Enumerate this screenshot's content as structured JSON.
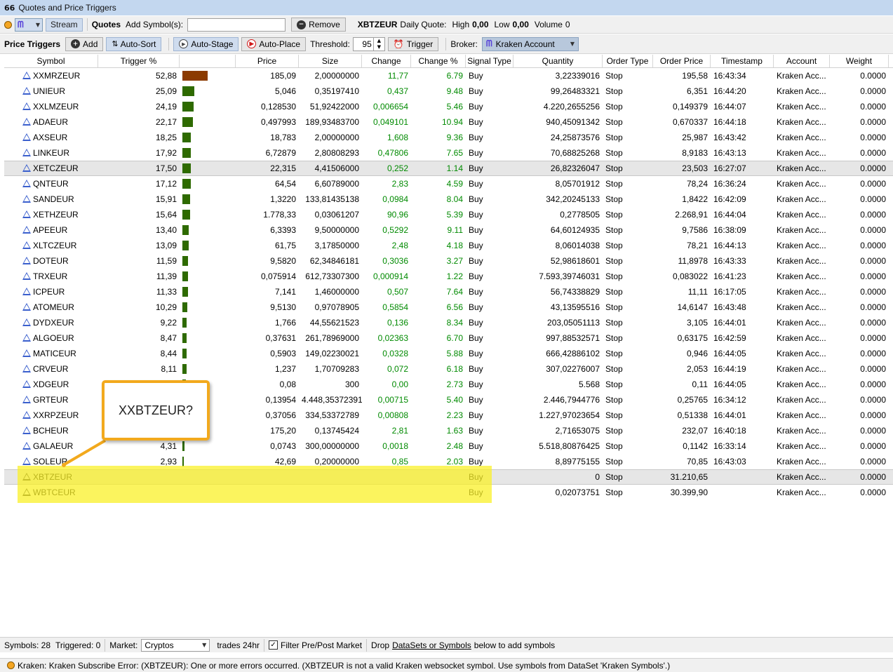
{
  "window": {
    "title": "Quotes and Price Triggers"
  },
  "quotes_bar": {
    "stream_label": "Stream",
    "quotes_label": "Quotes",
    "add_symbols_label": "Add Symbol(s):",
    "add_symbols_value": "",
    "remove_label": "Remove",
    "quote_symbol": "XBTZEUR",
    "daily_quote_label": "Daily Quote:",
    "high_label": "High",
    "high_value": "0,00",
    "low_label": "Low",
    "low_value": "0,00",
    "volume_label": "Volume",
    "volume_value": "0"
  },
  "trigger_bar": {
    "title": "Price Triggers",
    "add_label": "Add",
    "auto_sort_label": "Auto-Sort",
    "auto_stage_label": "Auto-Stage",
    "auto_place_label": "Auto-Place",
    "threshold_label": "Threshold:",
    "threshold_value": "95",
    "trigger_label": "Trigger",
    "broker_label": "Broker:",
    "broker_value": "Kraken Account"
  },
  "columns": [
    "Symbol",
    "Trigger %",
    "",
    "Price",
    "Size",
    "Change",
    "Change %",
    "Signal Type",
    "Quantity",
    "Order Type",
    "Order Price",
    "Timestamp",
    "Account",
    "Weight"
  ],
  "rows": [
    {
      "symbol": "XXMRZEUR",
      "trigger": "52,88",
      "level": 52.88,
      "price": "185,09",
      "size": "2,00000000",
      "change": "11,77",
      "change_pct": "6.79",
      "signal": "Buy",
      "quantity": "3,22339016",
      "order_type": "Stop",
      "order_price": "195,58",
      "timestamp": "16:43:34",
      "account": "Kraken Acc...",
      "weight": "0.0000"
    },
    {
      "symbol": "UNIEUR",
      "trigger": "25,09",
      "level": 25.09,
      "price": "5,046",
      "size": "0,35197410",
      "change": "0,437",
      "change_pct": "9.48",
      "signal": "Buy",
      "quantity": "99,26483321",
      "order_type": "Stop",
      "order_price": "6,351",
      "timestamp": "16:44:20",
      "account": "Kraken Acc...",
      "weight": "0.0000"
    },
    {
      "symbol": "XXLMZEUR",
      "trigger": "24,19",
      "level": 24.19,
      "price": "0,128530",
      "size": "51,92422000",
      "change": "0,006654",
      "change_pct": "5.46",
      "signal": "Buy",
      "quantity": "4.220,2655256",
      "order_type": "Stop",
      "order_price": "0,149379",
      "timestamp": "16:44:07",
      "account": "Kraken Acc...",
      "weight": "0.0000"
    },
    {
      "symbol": "ADAEUR",
      "trigger": "22,17",
      "level": 22.17,
      "price": "0,497993",
      "size": "189,93483700",
      "change": "0,049101",
      "change_pct": "10.94",
      "signal": "Buy",
      "quantity": "940,45091342",
      "order_type": "Stop",
      "order_price": "0,670337",
      "timestamp": "16:44:18",
      "account": "Kraken Acc...",
      "weight": "0.0000"
    },
    {
      "symbol": "AXSEUR",
      "trigger": "18,25",
      "level": 18.25,
      "price": "18,783",
      "size": "2,00000000",
      "change": "1,608",
      "change_pct": "9.36",
      "signal": "Buy",
      "quantity": "24,25873576",
      "order_type": "Stop",
      "order_price": "25,987",
      "timestamp": "16:43:42",
      "account": "Kraken Acc...",
      "weight": "0.0000"
    },
    {
      "symbol": "LINKEUR",
      "trigger": "17,92",
      "level": 17.92,
      "price": "6,72879",
      "size": "2,80808293",
      "change": "0,47806",
      "change_pct": "7.65",
      "signal": "Buy",
      "quantity": "70,68825268",
      "order_type": "Stop",
      "order_price": "8,9183",
      "timestamp": "16:43:13",
      "account": "Kraken Acc...",
      "weight": "0.0000"
    },
    {
      "symbol": "XETCZEUR",
      "trigger": "17,50",
      "level": 17.5,
      "price": "22,315",
      "size": "4,41506000",
      "change": "0,252",
      "change_pct": "1.14",
      "signal": "Buy",
      "quantity": "26,82326047",
      "order_type": "Stop",
      "order_price": "23,503",
      "timestamp": "16:27:07",
      "account": "Kraken Acc...",
      "weight": "0.0000",
      "selected": true
    },
    {
      "symbol": "QNTEUR",
      "trigger": "17,12",
      "level": 17.12,
      "price": "64,54",
      "size": "6,60789000",
      "change": "2,83",
      "change_pct": "4.59",
      "signal": "Buy",
      "quantity": "8,05701912",
      "order_type": "Stop",
      "order_price": "78,24",
      "timestamp": "16:36:24",
      "account": "Kraken Acc...",
      "weight": "0.0000"
    },
    {
      "symbol": "SANDEUR",
      "trigger": "15,91",
      "level": 15.91,
      "price": "1,3220",
      "size": "133,81435138",
      "change": "0,0984",
      "change_pct": "8.04",
      "signal": "Buy",
      "quantity": "342,20245133",
      "order_type": "Stop",
      "order_price": "1,8422",
      "timestamp": "16:42:09",
      "account": "Kraken Acc...",
      "weight": "0.0000"
    },
    {
      "symbol": "XETHZEUR",
      "trigger": "15,64",
      "level": 15.64,
      "price": "1.778,33",
      "size": "0,03061207",
      "change": "90,96",
      "change_pct": "5.39",
      "signal": "Buy",
      "quantity": "0,2778505",
      "order_type": "Stop",
      "order_price": "2.268,91",
      "timestamp": "16:44:04",
      "account": "Kraken Acc...",
      "weight": "0.0000"
    },
    {
      "symbol": "APEEUR",
      "trigger": "13,40",
      "level": 13.4,
      "price": "6,3393",
      "size": "9,50000000",
      "change": "0,5292",
      "change_pct": "9.11",
      "signal": "Buy",
      "quantity": "64,60124935",
      "order_type": "Stop",
      "order_price": "9,7586",
      "timestamp": "16:38:09",
      "account": "Kraken Acc...",
      "weight": "0.0000"
    },
    {
      "symbol": "XLTCZEUR",
      "trigger": "13,09",
      "level": 13.09,
      "price": "61,75",
      "size": "3,17850000",
      "change": "2,48",
      "change_pct": "4.18",
      "signal": "Buy",
      "quantity": "8,06014038",
      "order_type": "Stop",
      "order_price": "78,21",
      "timestamp": "16:44:13",
      "account": "Kraken Acc...",
      "weight": "0.0000"
    },
    {
      "symbol": "DOTEUR",
      "trigger": "11,59",
      "level": 11.59,
      "price": "9,5820",
      "size": "62,34846181",
      "change": "0,3036",
      "change_pct": "3.27",
      "signal": "Buy",
      "quantity": "52,98618601",
      "order_type": "Stop",
      "order_price": "11,8978",
      "timestamp": "16:43:33",
      "account": "Kraken Acc...",
      "weight": "0.0000"
    },
    {
      "symbol": "TRXEUR",
      "trigger": "11,39",
      "level": 11.39,
      "price": "0,075914",
      "size": "612,73307300",
      "change": "0,000914",
      "change_pct": "1.22",
      "signal": "Buy",
      "quantity": "7.593,39746031",
      "order_type": "Stop",
      "order_price": "0,083022",
      "timestamp": "16:41:23",
      "account": "Kraken Acc...",
      "weight": "0.0000"
    },
    {
      "symbol": "ICPEUR",
      "trigger": "11,33",
      "level": 11.33,
      "price": "7,141",
      "size": "1,46000000",
      "change": "0,507",
      "change_pct": "7.64",
      "signal": "Buy",
      "quantity": "56,74338829",
      "order_type": "Stop",
      "order_price": "11,11",
      "timestamp": "16:17:05",
      "account": "Kraken Acc...",
      "weight": "0.0000"
    },
    {
      "symbol": "ATOMEUR",
      "trigger": "10,29",
      "level": 10.29,
      "price": "9,5130",
      "size": "0,97078905",
      "change": "0,5854",
      "change_pct": "6.56",
      "signal": "Buy",
      "quantity": "43,13595516",
      "order_type": "Stop",
      "order_price": "14,6147",
      "timestamp": "16:43:48",
      "account": "Kraken Acc...",
      "weight": "0.0000"
    },
    {
      "symbol": "DYDXEUR",
      "trigger": "9,22",
      "level": 9.22,
      "price": "1,766",
      "size": "44,55621523",
      "change": "0,136",
      "change_pct": "8.34",
      "signal": "Buy",
      "quantity": "203,05051113",
      "order_type": "Stop",
      "order_price": "3,105",
      "timestamp": "16:44:01",
      "account": "Kraken Acc...",
      "weight": "0.0000"
    },
    {
      "symbol": "ALGOEUR",
      "trigger": "8,47",
      "level": 8.47,
      "price": "0,37631",
      "size": "261,78969000",
      "change": "0,02363",
      "change_pct": "6.70",
      "signal": "Buy",
      "quantity": "997,88532571",
      "order_type": "Stop",
      "order_price": "0,63175",
      "timestamp": "16:42:59",
      "account": "Kraken Acc...",
      "weight": "0.0000"
    },
    {
      "symbol": "MATICEUR",
      "trigger": "8,44",
      "level": 8.44,
      "price": "0,5903",
      "size": "149,02230021",
      "change": "0,0328",
      "change_pct": "5.88",
      "signal": "Buy",
      "quantity": "666,42886102",
      "order_type": "Stop",
      "order_price": "0,946",
      "timestamp": "16:44:05",
      "account": "Kraken Acc...",
      "weight": "0.0000"
    },
    {
      "symbol": "CRVEUR",
      "trigger": "8,11",
      "level": 8.11,
      "price": "1,237",
      "size": "1,70709283",
      "change": "0,072",
      "change_pct": "6.18",
      "signal": "Buy",
      "quantity": "307,02276007",
      "order_type": "Stop",
      "order_price": "2,053",
      "timestamp": "16:44:19",
      "account": "Kraken Acc...",
      "weight": "0.0000"
    },
    {
      "symbol": "XDGEUR",
      "trigger": "",
      "level": 7.5,
      "price": "0,08",
      "size": "300",
      "change": "0,00",
      "change_pct": "2.73",
      "signal": "Buy",
      "quantity": "5.568",
      "order_type": "Stop",
      "order_price": "0,11",
      "timestamp": "16:44:05",
      "account": "Kraken Acc...",
      "weight": "0.0000"
    },
    {
      "symbol": "GRTEUR",
      "trigger": "",
      "level": 7.0,
      "price": "0,13954",
      "size": "4.448,35372391",
      "change": "0,00715",
      "change_pct": "5.40",
      "signal": "Buy",
      "quantity": "2.446,7944776",
      "order_type": "Stop",
      "order_price": "0,25765",
      "timestamp": "16:34:12",
      "account": "Kraken Acc...",
      "weight": "0.0000"
    },
    {
      "symbol": "XXRPZEUR",
      "trigger": "",
      "level": 6.0,
      "price": "0,37056",
      "size": "334,53372789",
      "change": "0,00808",
      "change_pct": "2.23",
      "signal": "Buy",
      "quantity": "1.227,97023654",
      "order_type": "Stop",
      "order_price": "0,51338",
      "timestamp": "16:44:01",
      "account": "Kraken Acc...",
      "weight": "0.0000"
    },
    {
      "symbol": "BCHEUR",
      "trigger": "",
      "level": 5.0,
      "price": "175,20",
      "size": "0,13745424",
      "change": "2,81",
      "change_pct": "1.63",
      "signal": "Buy",
      "quantity": "2,71653075",
      "order_type": "Stop",
      "order_price": "232,07",
      "timestamp": "16:40:18",
      "account": "Kraken Acc...",
      "weight": "0.0000"
    },
    {
      "symbol": "GALAEUR",
      "trigger": "4,31",
      "level": 4.31,
      "price": "0,0743",
      "size": "300,00000000",
      "change": "0,0018",
      "change_pct": "2.48",
      "signal": "Buy",
      "quantity": "5.518,80876425",
      "order_type": "Stop",
      "order_price": "0,1142",
      "timestamp": "16:33:14",
      "account": "Kraken Acc...",
      "weight": "0.0000"
    },
    {
      "symbol": "SOLEUR",
      "trigger": "2,93",
      "level": 2.93,
      "price": "42,69",
      "size": "0,20000000",
      "change": "0,85",
      "change_pct": "2.03",
      "signal": "Buy",
      "quantity": "8,89775155",
      "order_type": "Stop",
      "order_price": "70,85",
      "timestamp": "16:43:03",
      "account": "Kraken Acc...",
      "weight": "0.0000"
    },
    {
      "symbol": "XBTZEUR",
      "trigger": "",
      "level": 0,
      "price": "",
      "size": "",
      "change": "",
      "change_pct": "",
      "signal": "Buy",
      "quantity": "0",
      "order_type": "Stop",
      "order_price": "31.210,65",
      "timestamp": "",
      "account": "Kraken Acc...",
      "weight": "0.0000",
      "selected": true
    },
    {
      "symbol": "WBTCEUR",
      "trigger": "",
      "level": 0,
      "price": "",
      "size": "",
      "change": "",
      "change_pct": "",
      "signal": "Buy",
      "quantity": "0,02073751",
      "order_type": "Stop",
      "order_price": "30.399,90",
      "timestamp": "",
      "account": "Kraken Acc...",
      "weight": "0.0000"
    }
  ],
  "bar_colors": {
    "top": "#8b3a00",
    "normal": "#2e6a00"
  },
  "callout": {
    "text": "XXBTZEUR?"
  },
  "footer": {
    "symbols_label": "Symbols: 28",
    "triggered_label": "Triggered: 0",
    "market_label": "Market:",
    "market_value": "Cryptos",
    "trades_label": "trades 24hr",
    "filter_label": "Filter Pre/Post Market",
    "drop_prefix": "Drop",
    "drop_link": "DataSets or Symbols",
    "drop_suffix": "below to add symbols"
  },
  "error_bar": {
    "text": "Kraken: Kraken Subscribe Error: (XBTZEUR): One or more errors occurred. (XBTZEUR is not a valid Kraken websocket symbol. Use symbols from DataSet 'Kraken Symbols'.)"
  }
}
